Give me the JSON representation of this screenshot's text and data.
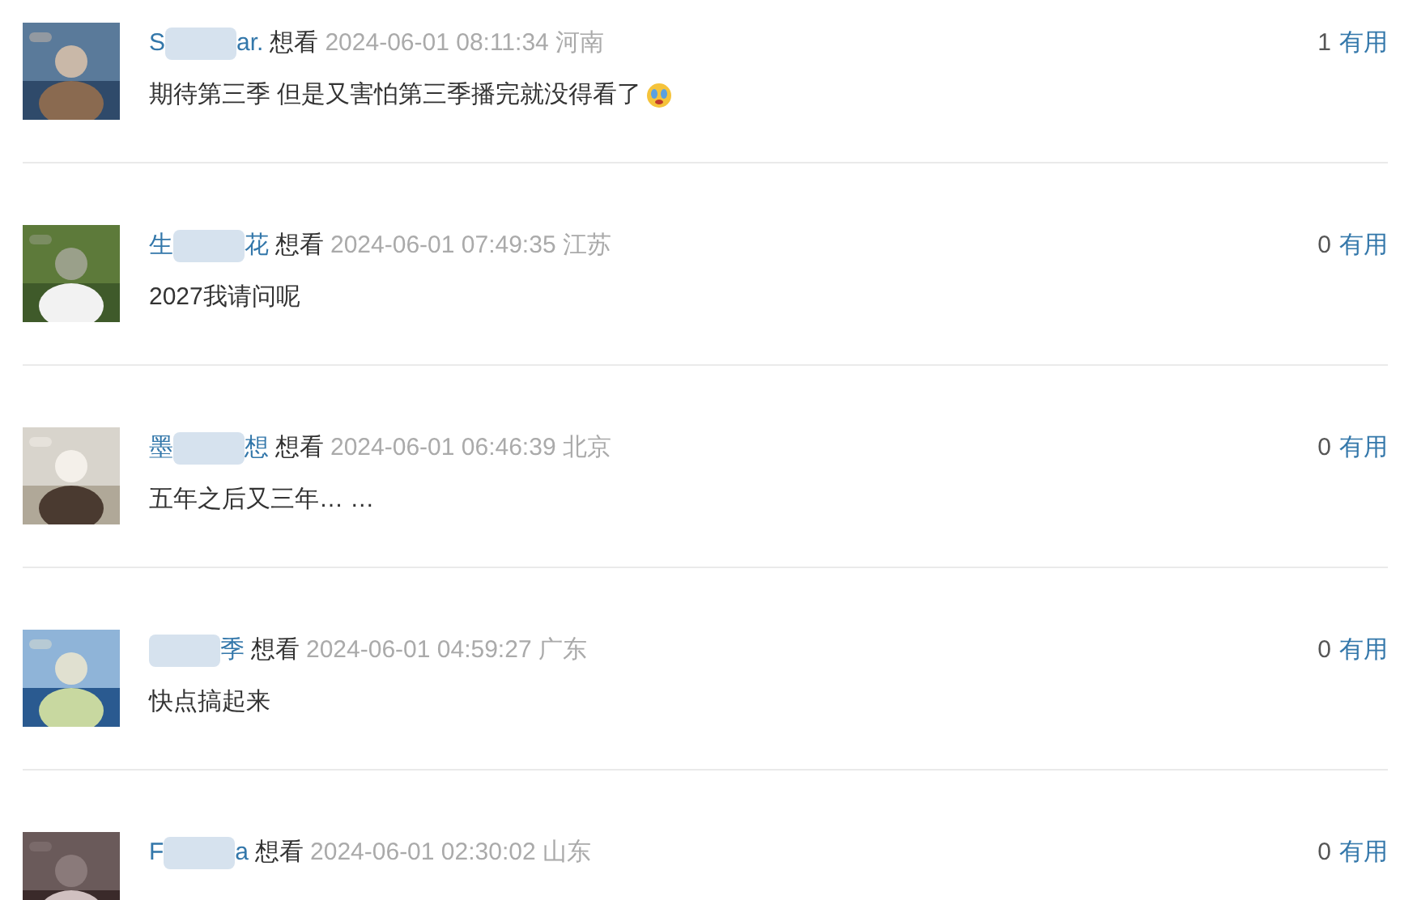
{
  "comments": [
    {
      "name_before": "S",
      "name_after": "ar.",
      "status": "想看",
      "time": "2024-06-01 08:11:34",
      "location": "河南",
      "text": "期待第三季 但是又害怕第三季播完就没得看了",
      "emoji": true,
      "votes": "1",
      "useful": "有用"
    },
    {
      "name_before": "生",
      "name_after": "花",
      "status": "想看",
      "time": "2024-06-01 07:49:35",
      "location": "江苏",
      "text": "2027我请问呢",
      "emoji": false,
      "votes": "0",
      "useful": "有用"
    },
    {
      "name_before": "墨",
      "name_after": "想",
      "status": "想看",
      "time": "2024-06-01 06:46:39",
      "location": "北京",
      "text": "五年之后又三年… …",
      "emoji": false,
      "votes": "0",
      "useful": "有用"
    },
    {
      "name_after": "季",
      "status": "想看",
      "time": "2024-06-01 04:59:27",
      "location": "广东",
      "text": "快点搞起来",
      "emoji": false,
      "votes": "0",
      "useful": "有用"
    },
    {
      "name_before": "F",
      "name_after": "a",
      "status": "想看",
      "time": "2024-06-01 02:30:02",
      "location": "山东",
      "votes": "0",
      "useful": "有用"
    }
  ]
}
